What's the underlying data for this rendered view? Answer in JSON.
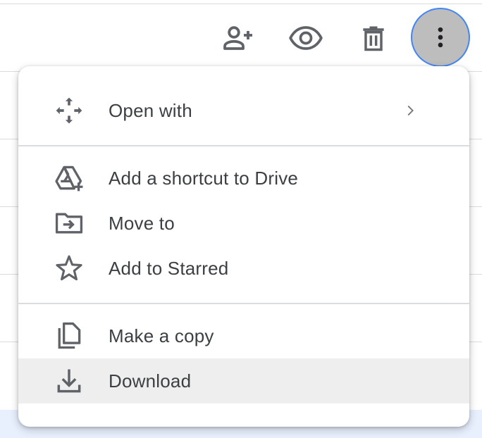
{
  "toolbar": {
    "share_icon": "add-person-icon",
    "preview_icon": "eye-icon",
    "delete_icon": "trash-icon",
    "more_icon": "more-vert-icon"
  },
  "menu": {
    "sections": [
      {
        "items": [
          {
            "label": "Open with",
            "icon": "move-arrows-icon",
            "has_submenu": true
          }
        ]
      },
      {
        "items": [
          {
            "label": "Add a shortcut to Drive",
            "icon": "drive-shortcut-icon"
          },
          {
            "label": "Move to",
            "icon": "folder-move-icon"
          },
          {
            "label": "Add to Starred",
            "icon": "star-icon"
          }
        ]
      },
      {
        "items": [
          {
            "label": "Make a copy",
            "icon": "copy-icon"
          },
          {
            "label": "Download",
            "icon": "download-icon",
            "highlighted": true
          }
        ]
      }
    ]
  },
  "colors": {
    "icon": "#5f6368",
    "text": "#3c4043",
    "divider": "#dadce0",
    "highlight": "#eeeeee",
    "more_button_bg": "#bdbdbd",
    "focus_ring": "#4285f4",
    "selected_row": "#e8f0fe"
  }
}
